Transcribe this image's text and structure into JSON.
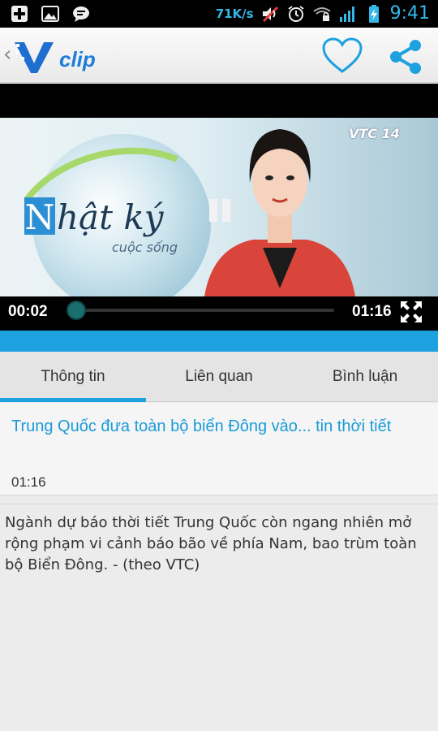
{
  "status_bar": {
    "net_speed": "71K/s",
    "time": "9:41",
    "icons": [
      "add-box-icon",
      "image-icon",
      "chat-bubble-icon",
      "mute-icon",
      "alarm-icon",
      "wifi-lock-icon",
      "signal-icon",
      "battery-charging-icon"
    ]
  },
  "app_bar": {
    "back_glyph": "‹",
    "logo_text": "clip",
    "logo_letter": "V"
  },
  "video": {
    "show_title_first": "N",
    "show_title_rest": "hật ký",
    "show_subtitle": "cuộc sống",
    "channel_logo": "VTC 14",
    "current_time": "00:02",
    "duration": "01:16",
    "progress": 0.03
  },
  "tabs": [
    {
      "label": "Thông tin",
      "active": true
    },
    {
      "label": "Liên quan",
      "active": false
    },
    {
      "label": "Bình luận",
      "active": false
    }
  ],
  "info": {
    "title": "Trung Quốc đưa toàn bộ biển Đông vào... tin thời tiết",
    "duration": "01:16"
  },
  "description": "Ngành dự báo thời tiết Trung Quốc còn ngang nhiên mở rộng phạm vi cảnh báo bão về phía Nam, bao trùm toàn bộ Biển Đông. - (theo VTC)",
  "colors": {
    "accent": "#1da1df",
    "title": "#1a9bd8"
  }
}
